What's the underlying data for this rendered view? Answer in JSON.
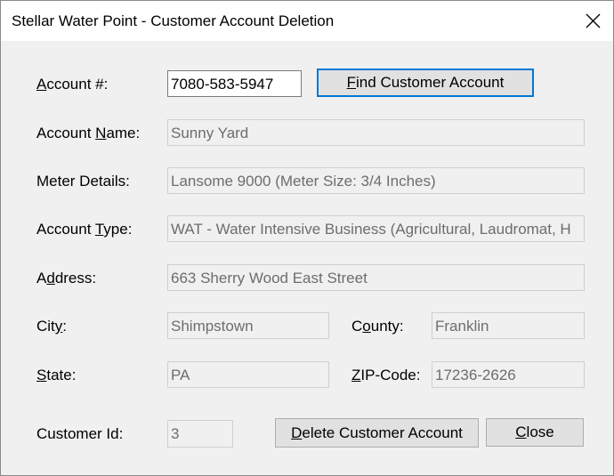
{
  "window": {
    "title": "Stellar Water Point - Customer Account Deletion"
  },
  "form": {
    "account_number": {
      "label_u": "A",
      "label_rest": "ccount #:",
      "value": "7080-583-5947"
    },
    "find_button": {
      "pre": "",
      "u": "F",
      "post": "ind Customer Account"
    },
    "account_name": {
      "label_pre": "Account ",
      "label_u": "N",
      "label_post": "ame:",
      "value": "Sunny Yard"
    },
    "meter_details": {
      "label": "Meter Details:",
      "value": "Lansome 9000 (Meter Size: 3/4 Inches)"
    },
    "account_type": {
      "label_pre": "Account ",
      "label_u": "T",
      "label_post": "ype:",
      "value": "WAT - Water Intensive Business (Agricultural, Laudromat, H"
    },
    "address": {
      "label_pre": "A",
      "label_u": "d",
      "label_post": "dress:",
      "value": "663 Sherry Wood East Street"
    },
    "city": {
      "label_pre": "Cit",
      "label_u": "y",
      "label_post": ":",
      "value": "Shimpstown"
    },
    "county": {
      "label_pre": "C",
      "label_u": "o",
      "label_post": "unty:",
      "value": "Franklin"
    },
    "state": {
      "label_pre": "",
      "label_u": "S",
      "label_post": "tate:",
      "value": "PA"
    },
    "zip": {
      "label_pre": "",
      "label_u": "Z",
      "label_post": "IP-Code:",
      "value": "17236-2626"
    },
    "customer_id": {
      "label": "Customer Id:",
      "value": "3"
    },
    "delete_button": {
      "pre": "",
      "u": "D",
      "post": "elete Customer Account"
    },
    "close_button": {
      "pre": "",
      "u": "C",
      "post": "lose"
    }
  }
}
